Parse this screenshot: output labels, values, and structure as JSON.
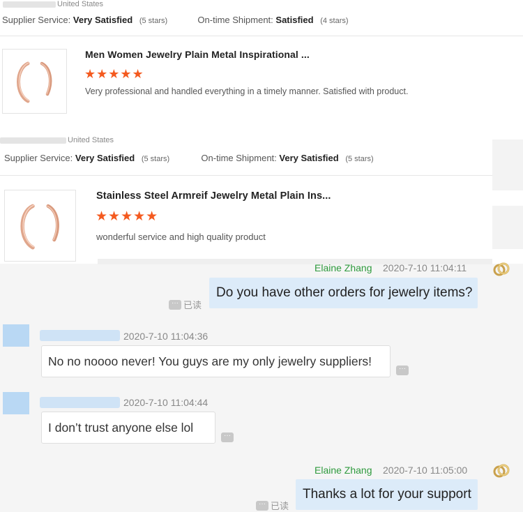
{
  "reviews": [
    {
      "country": "United States",
      "supplier_service_label": "Supplier Service:",
      "supplier_service_value": "Very Satisfied",
      "supplier_service_stars": "(5 stars)",
      "shipment_label": "On-time Shipment:",
      "shipment_value": "Satisfied",
      "shipment_stars": "(4 stars)"
    },
    {
      "product_title": "Men Women Jewelry Plain Metal Inspirational ...",
      "stars": "★★★★★",
      "rating": 5,
      "text": "Very professional and handled everything in a timely manner. Satisfied with product.",
      "country": "United States",
      "supplier_service_label": "Supplier Service:",
      "supplier_service_value": "Very Satisfied",
      "supplier_service_stars": "(5 stars)",
      "shipment_label": "On-time Shipment:",
      "shipment_value": "Very Satisfied",
      "shipment_stars": "(5 stars)"
    },
    {
      "product_title": "Stainless Steel Armreif Jewelry Metal Plain Ins...",
      "stars": "★★★★★",
      "rating": 5,
      "text": "wonderful service and high quality product"
    }
  ],
  "chat": {
    "messages": [
      {
        "sender": "Elaine Zhang",
        "time": "2020-7-10 11:04:11",
        "text": "Do you have other orders for jewelry items?",
        "status": "已读",
        "direction": "outgoing"
      },
      {
        "time": "2020-7-10 11:04:36",
        "text": "No no noooo never! You guys are my only jewelry suppliers!",
        "direction": "incoming"
      },
      {
        "time": "2020-7-10 11:04:44",
        "text": "I don’t trust anyone else lol",
        "direction": "incoming"
      },
      {
        "sender": "Elaine Zhang",
        "time": "2020-7-10 11:05:00",
        "text": "Thanks a lot for your support",
        "status": "已读",
        "direction": "outgoing"
      }
    ],
    "more_glyph": "···"
  },
  "colors": {
    "star": "#f45a1f",
    "sender_name": "#2e9a3d",
    "outgoing_bubble": "#dcebf9",
    "chat_background": "#f5f5f5"
  },
  "icons": {
    "product_image": "rose-gold-cuff-bracelet",
    "agent_avatar": "rings-avatar-icon",
    "more": "more-dots-icon"
  }
}
